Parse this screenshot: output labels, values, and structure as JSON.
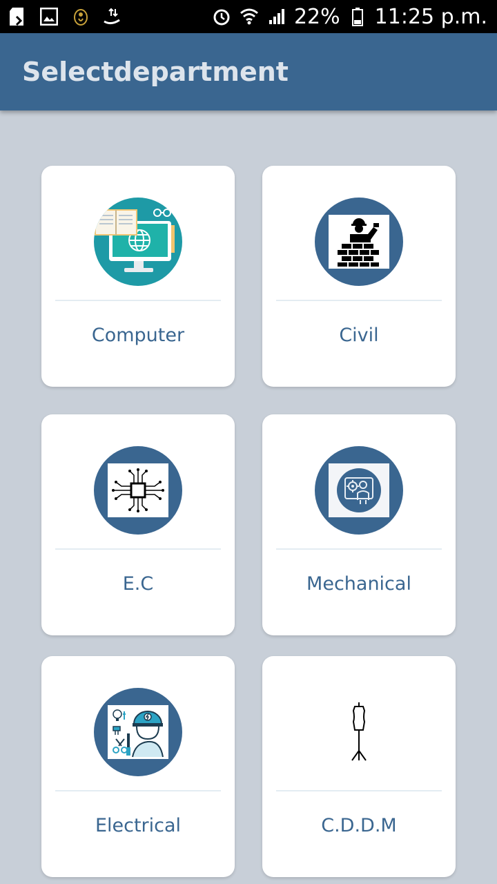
{
  "status_bar": {
    "battery": "22%",
    "time": "11:25 p.m."
  },
  "app_bar": {
    "title": "Selectdepartment"
  },
  "departments": [
    {
      "label": "Computer",
      "icon": "computer-icon"
    },
    {
      "label": "Civil",
      "icon": "construction-worker-icon"
    },
    {
      "label": "E.C",
      "icon": "circuit-chip-icon"
    },
    {
      "label": "Mechanical",
      "icon": "engineer-gear-icon"
    },
    {
      "label": "Electrical",
      "icon": "electrician-icon"
    },
    {
      "label": "C.D.D.M",
      "icon": "dress-form-icon"
    }
  ],
  "colors": {
    "primary": "#3a6690",
    "background": "#c8cfd8",
    "teal": "#1e9aa6"
  }
}
